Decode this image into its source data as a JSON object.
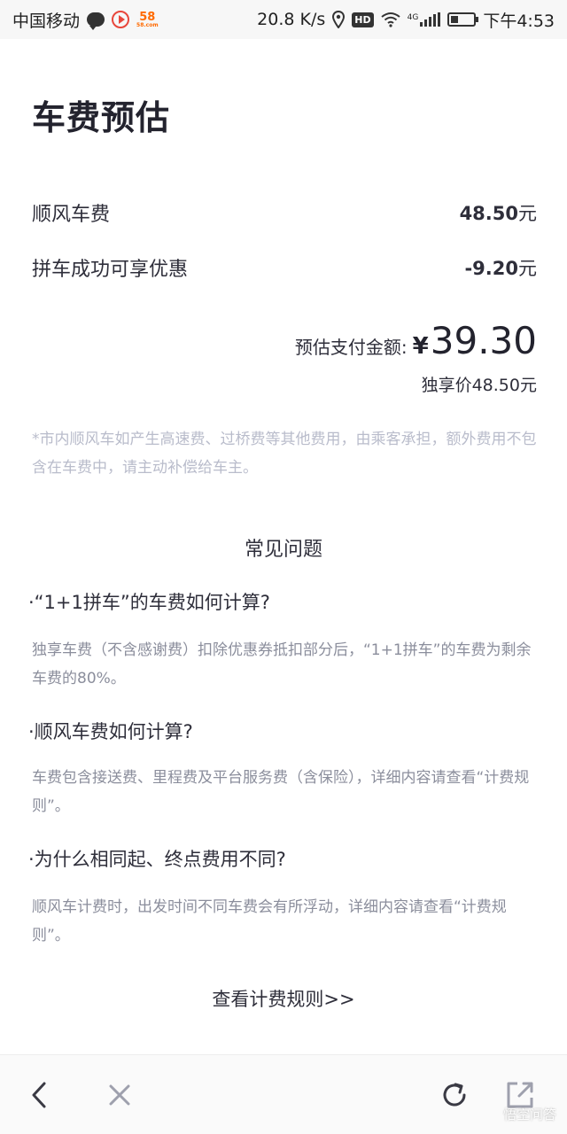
{
  "status_bar": {
    "carrier": "中国移动",
    "speed": "20.8 K/s",
    "hd": "HD",
    "network": "4G",
    "time": "下午4:53",
    "app58": "58"
  },
  "page": {
    "title": "车费预估"
  },
  "fees": [
    {
      "label": "顺风车费",
      "value": "48.50",
      "unit": "元"
    },
    {
      "label": "拼车成功可享优惠",
      "value": "-9.20",
      "unit": "元"
    }
  ],
  "payment": {
    "label": "预估支付金额:",
    "currency": "¥",
    "amount": "39.30",
    "exclusive_price": "独享价48.50元"
  },
  "note": "*市内顺风车如产生高速费、过桥费等其他费用，由乘客承担，额外费用不包含在车费中，请主动补偿给车主。",
  "faq": {
    "heading": "常见问题",
    "items": [
      {
        "question": "·“1+1拼车”的车费如何计算?",
        "answer": "独享车费（不含感谢费）扣除优惠券抵扣部分后，“1+1拼车”的车费为剩余车费的80%。"
      },
      {
        "question": "·顺风车费如何计算?",
        "answer": "车费包含接送费、里程费及平台服务费（含保险），详细内容请查看“计费规则”。"
      },
      {
        "question": "·为什么相同起、终点费用不同?",
        "answer": "顺风车计费时，出发时间不同车费会有所浮动，详细内容请查看“计费规则”。"
      }
    ]
  },
  "rules_link": "查看计费规则>>",
  "toolbar": {
    "back_icon": "chevron-left-icon",
    "close_icon": "close-icon",
    "refresh_icon": "refresh-icon",
    "share_icon": "share-icon"
  },
  "watermark": "悟空问答"
}
